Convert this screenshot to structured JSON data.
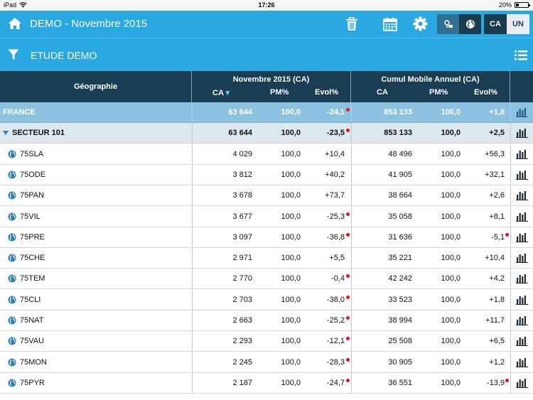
{
  "status_bar": {
    "device": "iPad",
    "time": "17:26",
    "battery": "20%"
  },
  "top_bar": {
    "title": "DEMO - Novembre 2015",
    "toggle_ca": "CA",
    "toggle_un": "UN"
  },
  "filter_bar": {
    "label": "ETUDE DEMO"
  },
  "table_header": {
    "geography": "Géographie",
    "group1": "Novembre 2015 (CA)",
    "group2": "Cumul Mobile Annuel (CA)",
    "col_ca": "CA",
    "sort_indicator": "▾",
    "col_pm": "PM%",
    "col_evol": "Evol%"
  },
  "colors": {
    "accent": "#2aa8e1",
    "header": "#193e53",
    "negative_dot": "#e0141e"
  },
  "rows": [
    {
      "name": "FRANCE",
      "type": "total",
      "ca1": "63 644",
      "pm1": "100,0",
      "ev1": "-24,1",
      "dot1": true,
      "ca2": "853 133",
      "pm2": "100,0",
      "ev2": "+1,8",
      "dot2": false
    },
    {
      "name": "SECTEUR 101",
      "type": "sector",
      "ca1": "63 644",
      "pm1": "100,0",
      "ev1": "-23,5",
      "dot1": true,
      "ca2": "853 133",
      "pm2": "100,0",
      "ev2": "+2,5",
      "dot2": false
    },
    {
      "name": "75SLA",
      "type": "item",
      "ca1": "4 029",
      "pm1": "100,0",
      "ev1": "+10,4",
      "dot1": false,
      "ca2": "48 496",
      "pm2": "100,0",
      "ev2": "+56,3",
      "dot2": false
    },
    {
      "name": "75ODE",
      "type": "item",
      "ca1": "3 812",
      "pm1": "100,0",
      "ev1": "+40,2",
      "dot1": false,
      "ca2": "41 905",
      "pm2": "100,0",
      "ev2": "+32,1",
      "dot2": false
    },
    {
      "name": "75PAN",
      "type": "item",
      "ca1": "3 678",
      "pm1": "100,0",
      "ev1": "+73,7",
      "dot1": false,
      "ca2": "38 664",
      "pm2": "100,0",
      "ev2": "+2,6",
      "dot2": false
    },
    {
      "name": "75VIL",
      "type": "item",
      "ca1": "3 677",
      "pm1": "100,0",
      "ev1": "-25,3",
      "dot1": true,
      "ca2": "35 058",
      "pm2": "100,0",
      "ev2": "+8,1",
      "dot2": false
    },
    {
      "name": "75PRE",
      "type": "item",
      "ca1": "3 097",
      "pm1": "100,0",
      "ev1": "-36,8",
      "dot1": true,
      "ca2": "31 636",
      "pm2": "100,0",
      "ev2": "-5,1",
      "dot2": true
    },
    {
      "name": "75CHE",
      "type": "item",
      "ca1": "2 971",
      "pm1": "100,0",
      "ev1": "+5,5",
      "dot1": false,
      "ca2": "35 221",
      "pm2": "100,0",
      "ev2": "+10,4",
      "dot2": false
    },
    {
      "name": "75TEM",
      "type": "item",
      "ca1": "2 770",
      "pm1": "100,0",
      "ev1": "-0,4",
      "dot1": true,
      "ca2": "42 242",
      "pm2": "100,0",
      "ev2": "+4,2",
      "dot2": false
    },
    {
      "name": "75CLI",
      "type": "item",
      "ca1": "2 703",
      "pm1": "100,0",
      "ev1": "-38,0",
      "dot1": true,
      "ca2": "33 523",
      "pm2": "100,0",
      "ev2": "+1,8",
      "dot2": false
    },
    {
      "name": "75NAT",
      "type": "item",
      "ca1": "2 663",
      "pm1": "100,0",
      "ev1": "-25,2",
      "dot1": true,
      "ca2": "38 994",
      "pm2": "100,0",
      "ev2": "+11,7",
      "dot2": false
    },
    {
      "name": "75VAU",
      "type": "item",
      "ca1": "2 293",
      "pm1": "100,0",
      "ev1": "-12,1",
      "dot1": true,
      "ca2": "25 508",
      "pm2": "100,0",
      "ev2": "+6,5",
      "dot2": false
    },
    {
      "name": "75MON",
      "type": "item",
      "ca1": "2 245",
      "pm1": "100,0",
      "ev1": "-28,3",
      "dot1": true,
      "ca2": "30 905",
      "pm2": "100,0",
      "ev2": "+1,2",
      "dot2": false
    },
    {
      "name": "75PYR",
      "type": "item",
      "ca1": "2 187",
      "pm1": "100,0",
      "ev1": "-24,7",
      "dot1": true,
      "ca2": "36 551",
      "pm2": "100,0",
      "ev2": "-13,9",
      "dot2": true
    }
  ]
}
